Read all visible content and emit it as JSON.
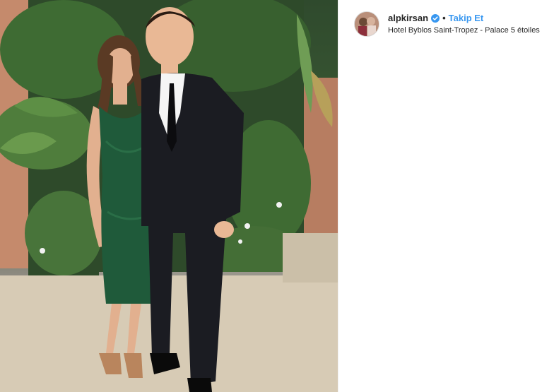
{
  "post": {
    "username": "alpkirsan",
    "follow_label": "Takip Et",
    "separator": "•",
    "location": "Hotel Byblos Saint-Tropez - Palace 5 étoiles"
  },
  "icons": {
    "verified": "verified-badge-icon"
  },
  "colors": {
    "follow": "#3897f0",
    "verified": "#3897f0",
    "username": "#262626"
  }
}
